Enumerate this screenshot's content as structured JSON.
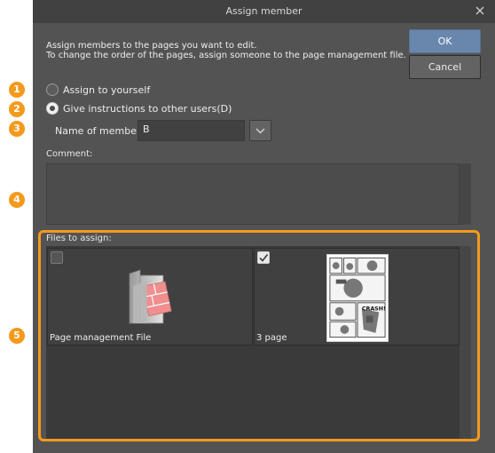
{
  "window": {
    "title": "Assign member"
  },
  "instructions": {
    "line1": "Assign members to the pages you want to edit.",
    "line2": "To change the order of the pages, assign someone to the page management file."
  },
  "buttons": {
    "ok": "OK",
    "cancel": "Cancel"
  },
  "options": {
    "assign_yourself": {
      "label": "Assign to yourself",
      "selected": false
    },
    "give_instructions": {
      "label": "Give instructions to other users(D)",
      "selected": true
    }
  },
  "member": {
    "label": "Name of member:",
    "value": "B"
  },
  "comment": {
    "label": "Comment:",
    "value": ""
  },
  "files": {
    "label": "Files to assign:",
    "items": [
      {
        "name": "Page management File",
        "checked": false,
        "icon": "folder-icon"
      },
      {
        "name": "3 page",
        "checked": true,
        "icon": "page-thumbnail"
      }
    ]
  },
  "badges": [
    "1",
    "2",
    "3",
    "4",
    "5"
  ],
  "colors": {
    "accent": "#f39a1c",
    "ok_button": "#6986ad",
    "background": "#535353"
  }
}
